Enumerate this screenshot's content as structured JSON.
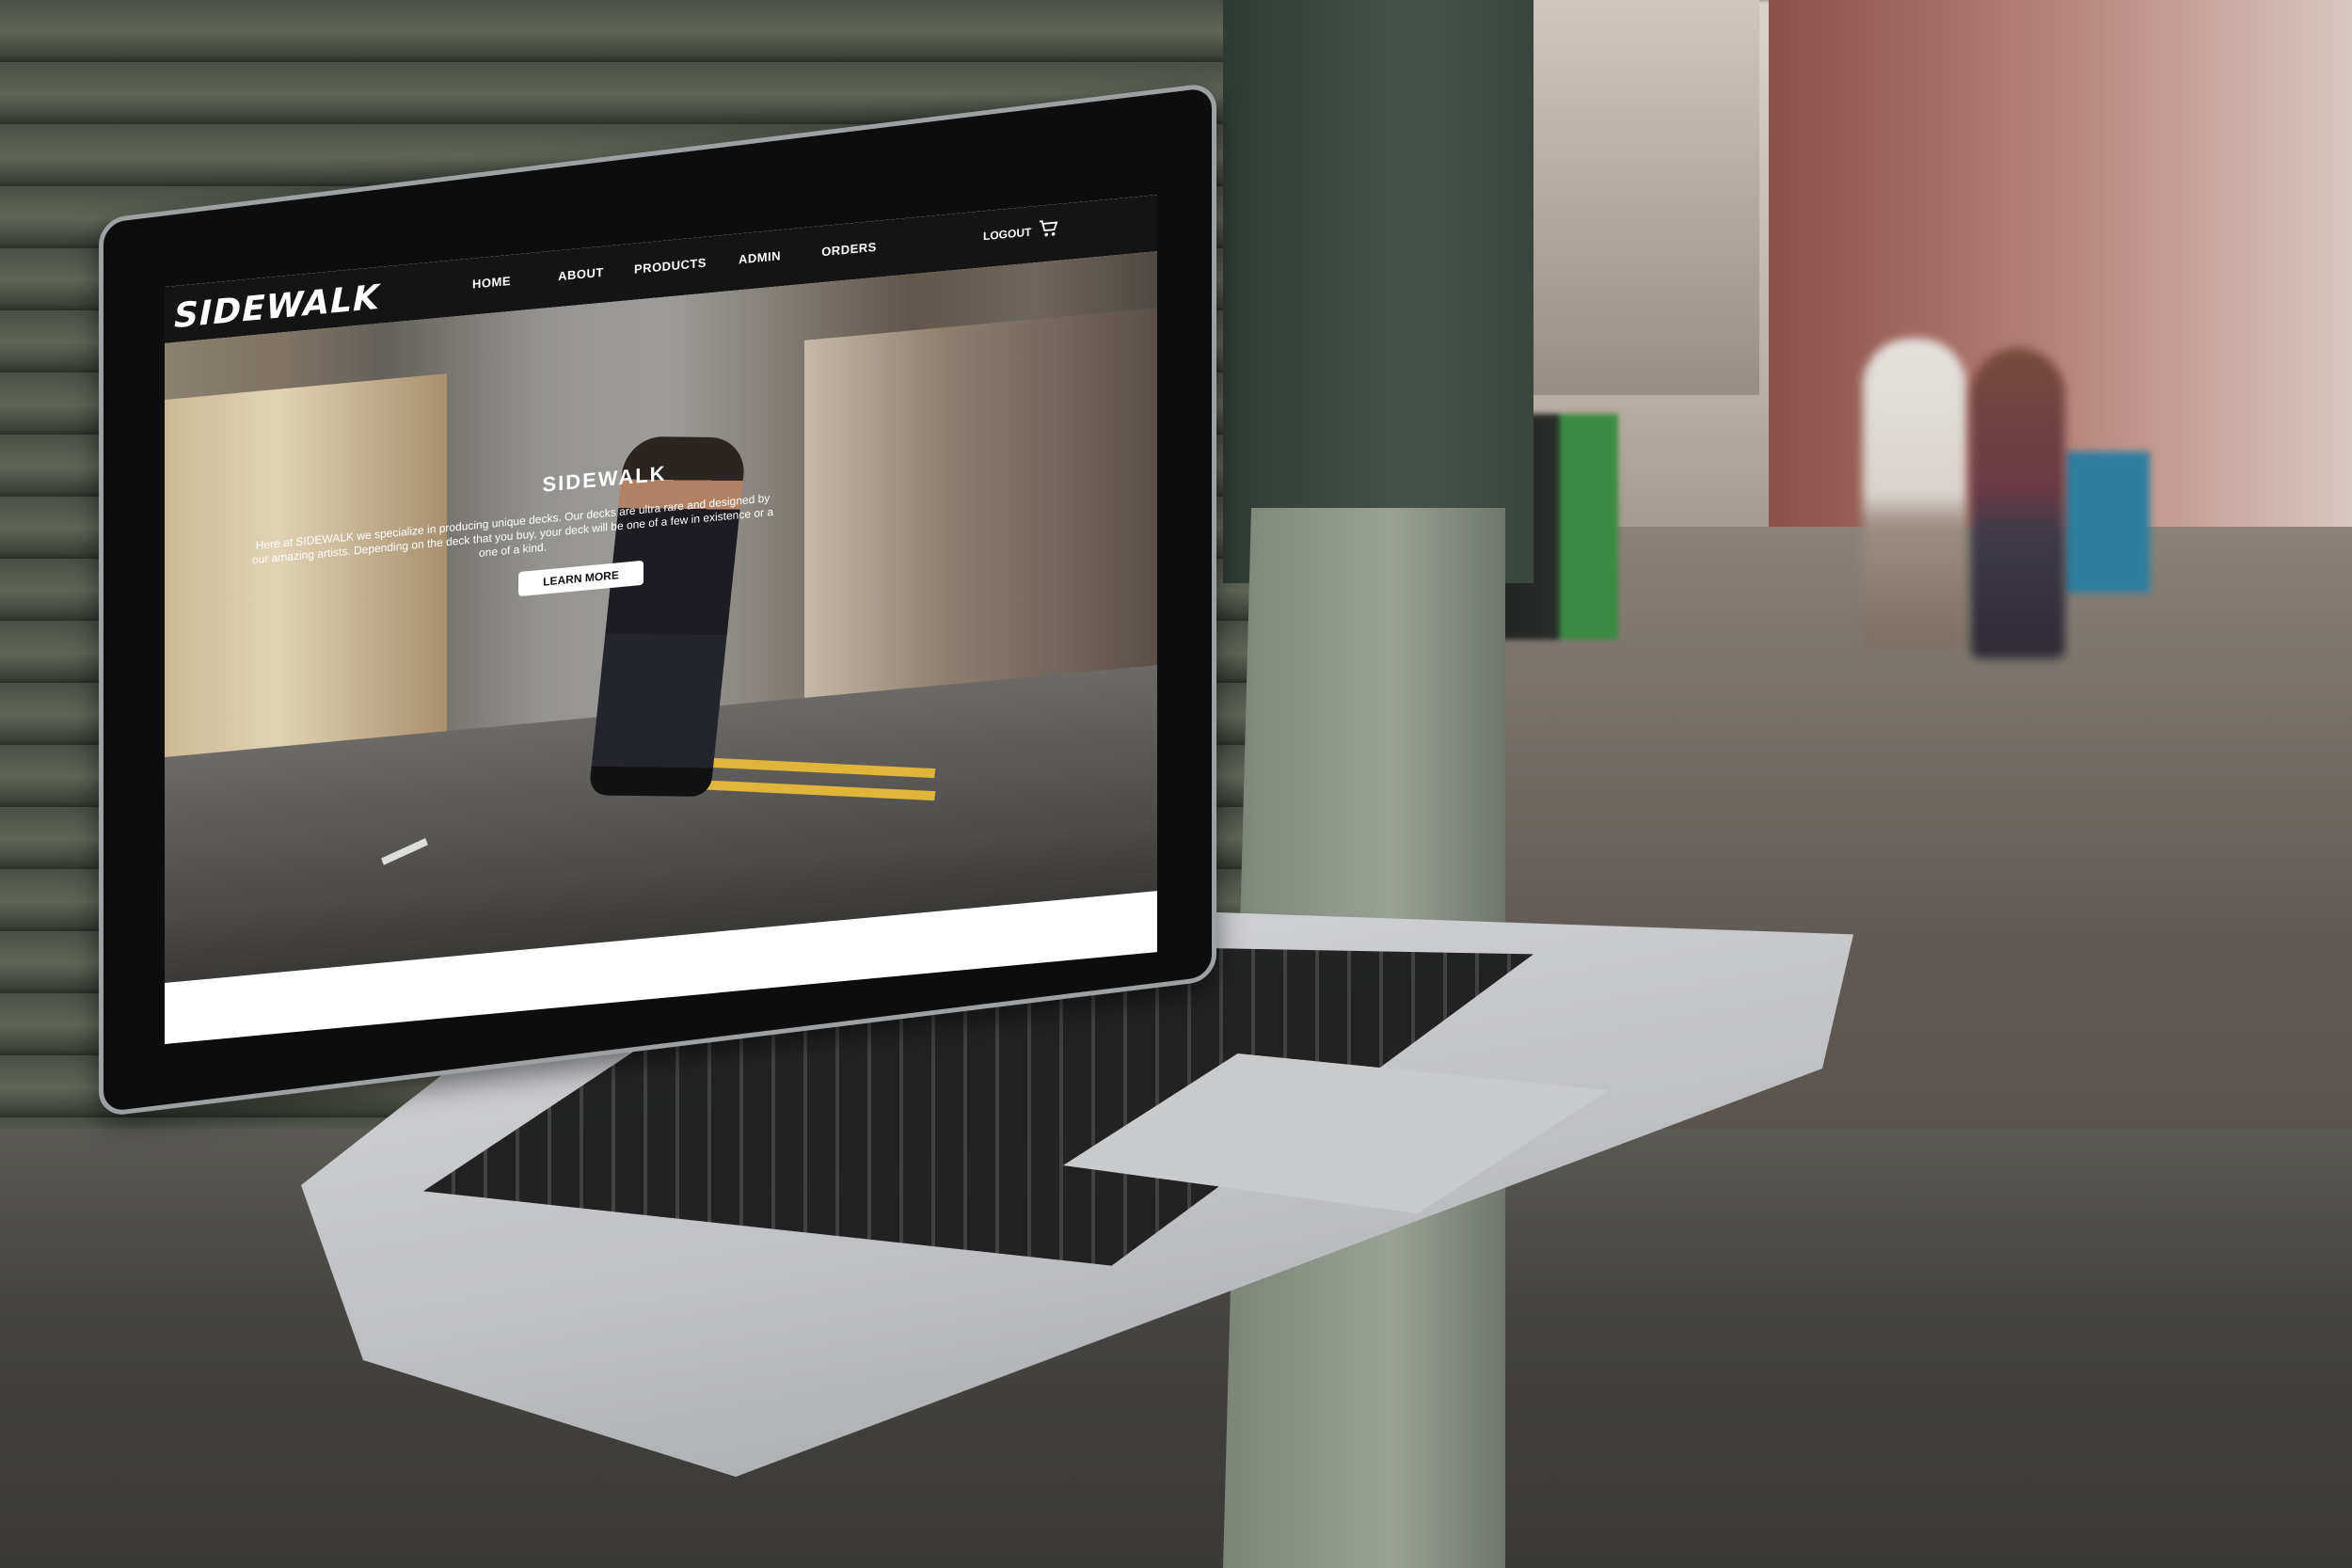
{
  "site": {
    "logo": "SIDEWALK"
  },
  "nav": {
    "links": [
      "HOME",
      "ABOUT",
      "PRODUCTS",
      "ADMIN",
      "ORDERS"
    ],
    "logout": "LOGOUT"
  },
  "hero": {
    "title": "SIDEWALK",
    "text": "Here at SIDEWALK we specialize in producing unique decks. Our decks are ultra rare and designed by our amazing artists. Depending on the deck that you buy, your deck will be one of a few in existence or a one of a kind.",
    "button": "LEARN MORE"
  },
  "colors": {
    "navbar": "#141414",
    "button_bg": "#ffffff"
  },
  "icons": {
    "cart": "cart-icon"
  }
}
